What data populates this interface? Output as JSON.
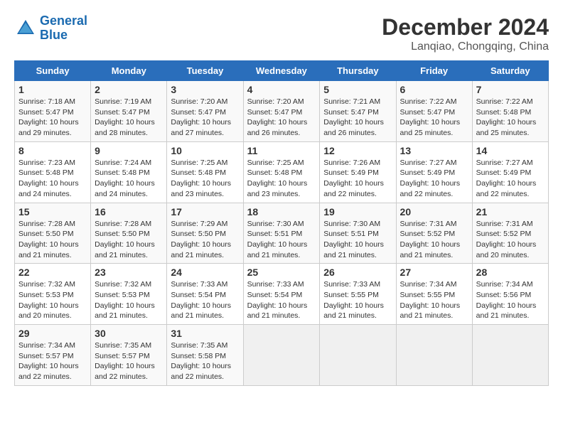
{
  "logo": {
    "line1": "General",
    "line2": "Blue"
  },
  "title": "December 2024",
  "subtitle": "Lanqiao, Chongqing, China",
  "weekdays": [
    "Sunday",
    "Monday",
    "Tuesday",
    "Wednesday",
    "Thursday",
    "Friday",
    "Saturday"
  ],
  "weeks": [
    [
      {
        "day": "1",
        "detail": "Sunrise: 7:18 AM\nSunset: 5:47 PM\nDaylight: 10 hours\nand 29 minutes."
      },
      {
        "day": "2",
        "detail": "Sunrise: 7:19 AM\nSunset: 5:47 PM\nDaylight: 10 hours\nand 28 minutes."
      },
      {
        "day": "3",
        "detail": "Sunrise: 7:20 AM\nSunset: 5:47 PM\nDaylight: 10 hours\nand 27 minutes."
      },
      {
        "day": "4",
        "detail": "Sunrise: 7:20 AM\nSunset: 5:47 PM\nDaylight: 10 hours\nand 26 minutes."
      },
      {
        "day": "5",
        "detail": "Sunrise: 7:21 AM\nSunset: 5:47 PM\nDaylight: 10 hours\nand 26 minutes."
      },
      {
        "day": "6",
        "detail": "Sunrise: 7:22 AM\nSunset: 5:47 PM\nDaylight: 10 hours\nand 25 minutes."
      },
      {
        "day": "7",
        "detail": "Sunrise: 7:22 AM\nSunset: 5:48 PM\nDaylight: 10 hours\nand 25 minutes."
      }
    ],
    [
      {
        "day": "8",
        "detail": "Sunrise: 7:23 AM\nSunset: 5:48 PM\nDaylight: 10 hours\nand 24 minutes."
      },
      {
        "day": "9",
        "detail": "Sunrise: 7:24 AM\nSunset: 5:48 PM\nDaylight: 10 hours\nand 24 minutes."
      },
      {
        "day": "10",
        "detail": "Sunrise: 7:25 AM\nSunset: 5:48 PM\nDaylight: 10 hours\nand 23 minutes."
      },
      {
        "day": "11",
        "detail": "Sunrise: 7:25 AM\nSunset: 5:48 PM\nDaylight: 10 hours\nand 23 minutes."
      },
      {
        "day": "12",
        "detail": "Sunrise: 7:26 AM\nSunset: 5:49 PM\nDaylight: 10 hours\nand 22 minutes."
      },
      {
        "day": "13",
        "detail": "Sunrise: 7:27 AM\nSunset: 5:49 PM\nDaylight: 10 hours\nand 22 minutes."
      },
      {
        "day": "14",
        "detail": "Sunrise: 7:27 AM\nSunset: 5:49 PM\nDaylight: 10 hours\nand 22 minutes."
      }
    ],
    [
      {
        "day": "15",
        "detail": "Sunrise: 7:28 AM\nSunset: 5:50 PM\nDaylight: 10 hours\nand 21 minutes."
      },
      {
        "day": "16",
        "detail": "Sunrise: 7:28 AM\nSunset: 5:50 PM\nDaylight: 10 hours\nand 21 minutes."
      },
      {
        "day": "17",
        "detail": "Sunrise: 7:29 AM\nSunset: 5:50 PM\nDaylight: 10 hours\nand 21 minutes."
      },
      {
        "day": "18",
        "detail": "Sunrise: 7:30 AM\nSunset: 5:51 PM\nDaylight: 10 hours\nand 21 minutes."
      },
      {
        "day": "19",
        "detail": "Sunrise: 7:30 AM\nSunset: 5:51 PM\nDaylight: 10 hours\nand 21 minutes."
      },
      {
        "day": "20",
        "detail": "Sunrise: 7:31 AM\nSunset: 5:52 PM\nDaylight: 10 hours\nand 21 minutes."
      },
      {
        "day": "21",
        "detail": "Sunrise: 7:31 AM\nSunset: 5:52 PM\nDaylight: 10 hours\nand 20 minutes."
      }
    ],
    [
      {
        "day": "22",
        "detail": "Sunrise: 7:32 AM\nSunset: 5:53 PM\nDaylight: 10 hours\nand 20 minutes."
      },
      {
        "day": "23",
        "detail": "Sunrise: 7:32 AM\nSunset: 5:53 PM\nDaylight: 10 hours\nand 21 minutes."
      },
      {
        "day": "24",
        "detail": "Sunrise: 7:33 AM\nSunset: 5:54 PM\nDaylight: 10 hours\nand 21 minutes."
      },
      {
        "day": "25",
        "detail": "Sunrise: 7:33 AM\nSunset: 5:54 PM\nDaylight: 10 hours\nand 21 minutes."
      },
      {
        "day": "26",
        "detail": "Sunrise: 7:33 AM\nSunset: 5:55 PM\nDaylight: 10 hours\nand 21 minutes."
      },
      {
        "day": "27",
        "detail": "Sunrise: 7:34 AM\nSunset: 5:55 PM\nDaylight: 10 hours\nand 21 minutes."
      },
      {
        "day": "28",
        "detail": "Sunrise: 7:34 AM\nSunset: 5:56 PM\nDaylight: 10 hours\nand 21 minutes."
      }
    ],
    [
      {
        "day": "29",
        "detail": "Sunrise: 7:34 AM\nSunset: 5:57 PM\nDaylight: 10 hours\nand 22 minutes."
      },
      {
        "day": "30",
        "detail": "Sunrise: 7:35 AM\nSunset: 5:57 PM\nDaylight: 10 hours\nand 22 minutes."
      },
      {
        "day": "31",
        "detail": "Sunrise: 7:35 AM\nSunset: 5:58 PM\nDaylight: 10 hours\nand 22 minutes."
      },
      {
        "day": "",
        "detail": ""
      },
      {
        "day": "",
        "detail": ""
      },
      {
        "day": "",
        "detail": ""
      },
      {
        "day": "",
        "detail": ""
      }
    ]
  ]
}
